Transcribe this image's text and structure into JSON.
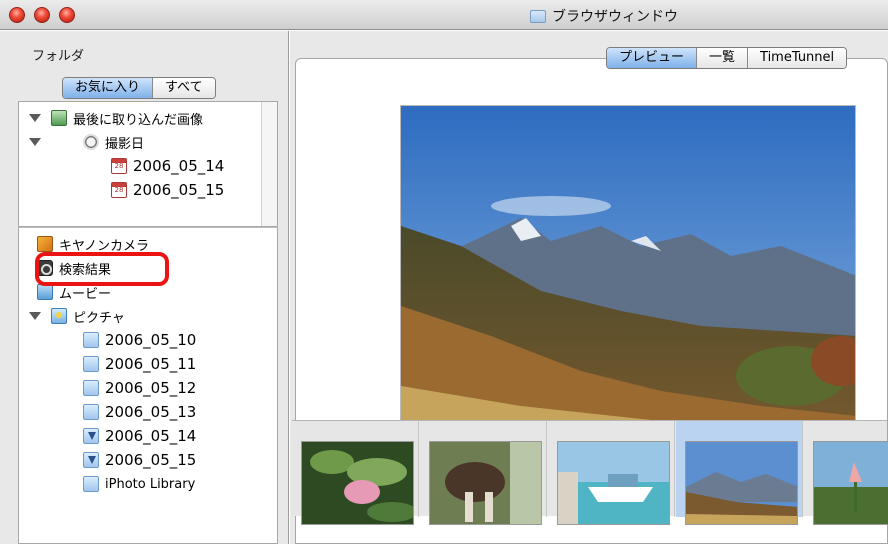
{
  "window": {
    "title": "ブラウザウィンドウ"
  },
  "left_panel": {
    "header": "フォルダ",
    "tabs": [
      {
        "label": "お気に入り",
        "selected": true
      },
      {
        "label": "すべて",
        "selected": false
      }
    ],
    "favorites_tree": {
      "recent": {
        "label": "最後に取り込んだ画像",
        "icon": "images-icon"
      },
      "shoot_date": {
        "label": "撮影日",
        "icon": "clock-icon"
      },
      "dates": [
        {
          "label": "2006_05_14",
          "icon": "calendar-icon"
        },
        {
          "label": "2006_05_15",
          "icon": "calendar-icon"
        }
      ]
    },
    "folders_tree": {
      "camera": {
        "label": "キヤノンカメラ",
        "icon": "camera-icon"
      },
      "search_results": {
        "label": "検索結果",
        "icon": "search-icon",
        "highlighted": true
      },
      "movies": {
        "label": "ムービー",
        "icon": "movie-icon"
      },
      "pictures": {
        "label": "ピクチャ",
        "icon": "pictures-icon"
      },
      "subfolders": [
        {
          "label": "2006_05_10",
          "icon": "folder-icon"
        },
        {
          "label": "2006_05_11",
          "icon": "folder-icon"
        },
        {
          "label": "2006_05_12",
          "icon": "folder-icon"
        },
        {
          "label": "2006_05_13",
          "icon": "folder-icon"
        },
        {
          "label": "2006_05_14",
          "icon": "download-folder-icon"
        },
        {
          "label": "2006_05_15",
          "icon": "download-folder-icon"
        },
        {
          "label": "iPhoto Library",
          "icon": "folder-icon"
        }
      ]
    }
  },
  "right_panel": {
    "view_tabs": [
      {
        "label": "プレビュー",
        "selected": true
      },
      {
        "label": "一覧",
        "selected": false
      },
      {
        "label": "TimeTunnel",
        "selected": false
      }
    ],
    "preview_subject": "mountain-landscape",
    "thumbnails": [
      {
        "subject": "pink-flower",
        "selected": false
      },
      {
        "subject": "okapi",
        "selected": false
      },
      {
        "subject": "boats-pier",
        "selected": false
      },
      {
        "subject": "mountain-landscape",
        "selected": true
      },
      {
        "subject": "lily-flower",
        "selected": false
      }
    ]
  },
  "colors": {
    "highlight_ring": "#ea1414",
    "selected_tab": "#7fb1ea",
    "selected_thumb_bg": "#b9d3f0"
  }
}
